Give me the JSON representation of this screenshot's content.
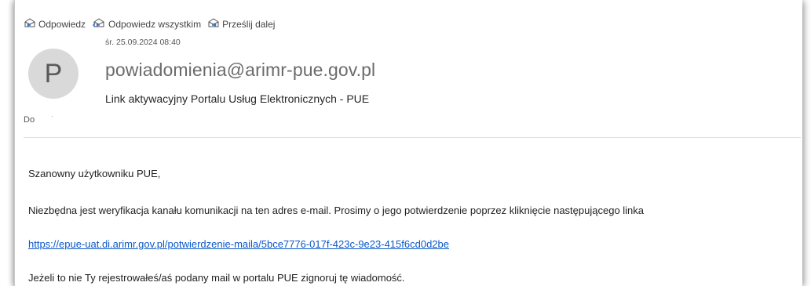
{
  "toolbar": {
    "reply_label": "Odpowiedz",
    "reply_all_label": "Odpowiedz wszystkim",
    "forward_label": "Prześlij dalej"
  },
  "message": {
    "date": "śr. 25.09.2024 08:40",
    "avatar_initial": "P",
    "sender": "powiadomienia@arimr-pue.gov.pl",
    "subject": "Link aktywacyjny Portalu Usług Elektronicznych - PUE",
    "to_label": "Do",
    "to_value": "·"
  },
  "body": {
    "greeting": "Szanowny użytkowniku PUE,",
    "paragraph1": "Niezbędna jest weryfikacja kanału komunikacji na ten adres e-mail. Prosimy o jego potwierdzenie poprzez kliknięcie następującego linka",
    "link": "https://epue-uat.di.arimr.gov.pl/potwierdzenie-maila/5bce7776-017f-423c-9e23-415f6cd0d2be",
    "paragraph2": "Jeżeli to nie Ty rejestrowałeś/aś podany mail w portalu PUE zignoruj tę wiadomość."
  },
  "colors": {
    "link": "#0b58c8",
    "avatar_bg": "#d9d9d9",
    "icon_accent": "#2f6fbd"
  }
}
